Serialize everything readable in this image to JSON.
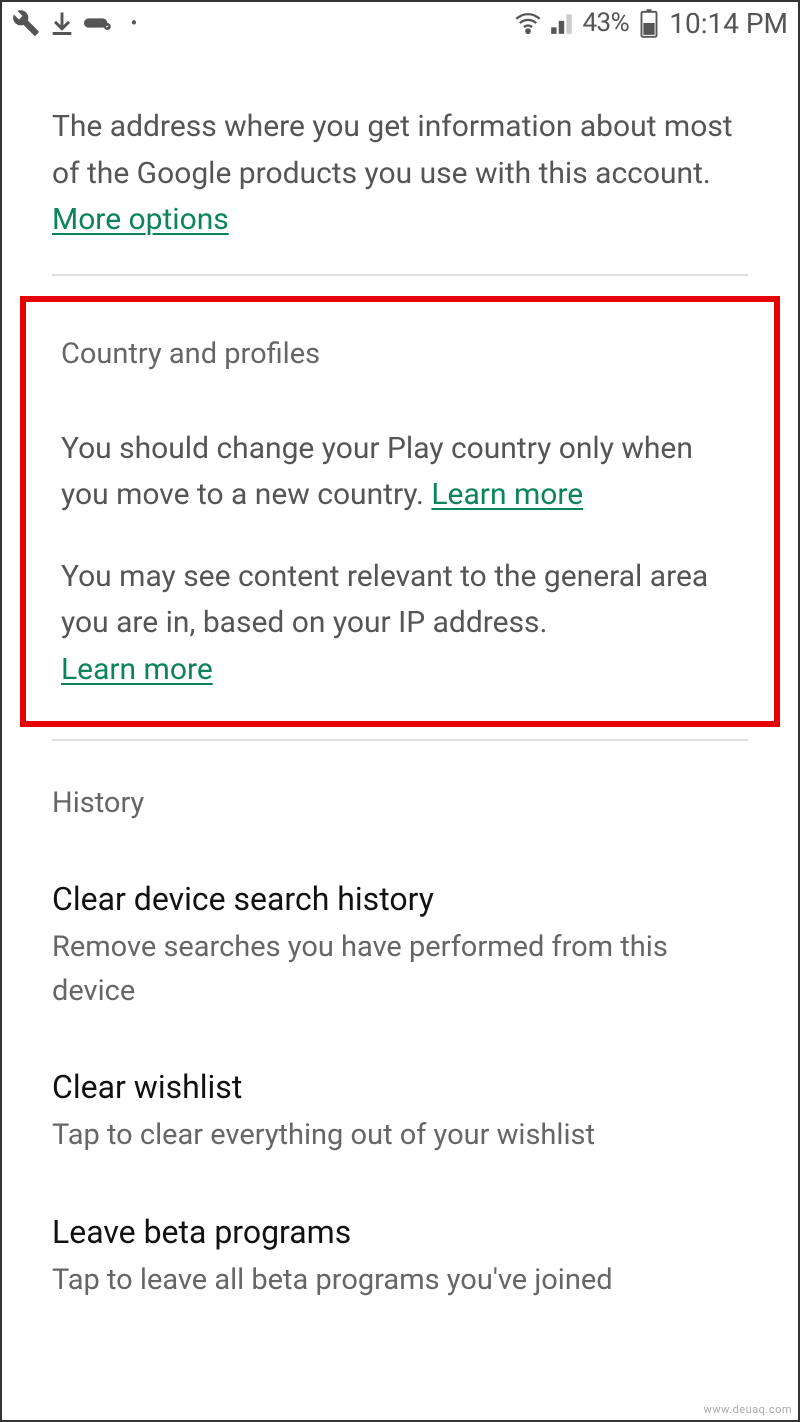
{
  "status_bar": {
    "battery_percent": "43%",
    "time": "10:14 PM"
  },
  "address_section": {
    "text": "The address where you get information about most of the Google products you use with this account. ",
    "link": "More options"
  },
  "country_section": {
    "heading": "Country and profiles",
    "para1_text": "You should change your Play country only when you move to a new country. ",
    "para1_link": "Learn more",
    "para2_text": "You may see content relevant to the general area you are in, based on your IP address. ",
    "para2_link": "Learn more"
  },
  "history_section": {
    "heading": "History",
    "items": [
      {
        "title": "Clear device search history",
        "desc": "Remove searches you have performed from this device"
      },
      {
        "title": "Clear wishlist",
        "desc": "Tap to clear everything out of your wishlist"
      },
      {
        "title": "Leave beta programs",
        "desc": "Tap to leave all beta programs you've joined"
      }
    ]
  },
  "watermark": "www.deuaq.com"
}
